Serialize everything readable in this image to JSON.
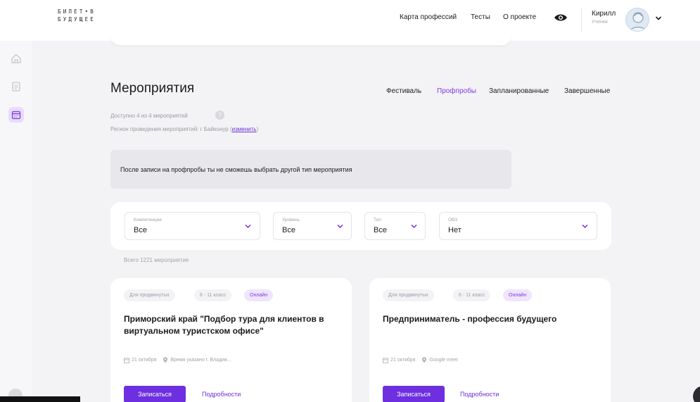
{
  "header": {
    "logo_line1": "БИЛЕТ•В",
    "logo_line2": "БУДУЩЕЕ",
    "nav": [
      "Карта профессий",
      "Тесты",
      "О проекте"
    ],
    "user": {
      "name": "Кирилл",
      "role": "Ученик"
    }
  },
  "page": {
    "title": "Мероприятия",
    "tabs": [
      "Фестиваль",
      "Профпробы",
      "Запланированные",
      "Завершенные"
    ],
    "active_tab": "Профпробы",
    "available_text": "Доступно 4 из 4 мероприятий",
    "help_mark": "?",
    "region_text": "Регион проведения мероприятий: г Байконур",
    "region_link": "изменить",
    "notice": "После записи на профпробы ты не сможешь выбрать другой тип мероприятия",
    "total_text": "Всего 1221 мероприятие"
  },
  "filters": [
    {
      "label": "Компетенция",
      "value": "Все"
    },
    {
      "label": "Уровень",
      "value": "Все"
    },
    {
      "label": "Тип",
      "value": "Все"
    },
    {
      "label": "ОВЗ",
      "value": "Нет"
    }
  ],
  "cards": [
    {
      "tags": [
        "Для продвинутых",
        "6 - 11 класс",
        "Онлайн"
      ],
      "title_line1": "Приморский край \"Подбор тура для клиентов в",
      "title_line2": "виртуальном туристском офисе\"",
      "date": "21 октября",
      "location": "Время указано г. Владив...",
      "signup_label": "Записаться",
      "details_label": "Подробности"
    },
    {
      "tags": [
        "Для продвинутых",
        "6 - 11 класс",
        "Онлайн"
      ],
      "title_line1": "Предприниматель - профессия будущего",
      "title_line2": "",
      "date": "21 октября",
      "location": "Google meet",
      "signup_label": "Записаться",
      "details_label": "Подробности"
    }
  ],
  "colors": {
    "accent": "#6d2fe0",
    "background": "#f3f3f6",
    "notice_bg": "#e7e7ec"
  },
  "icons": [
    "home-icon",
    "document-icon",
    "calendar-icon",
    "eye-icon",
    "chevron-down-icon",
    "location-pin-icon",
    "question-icon"
  ]
}
